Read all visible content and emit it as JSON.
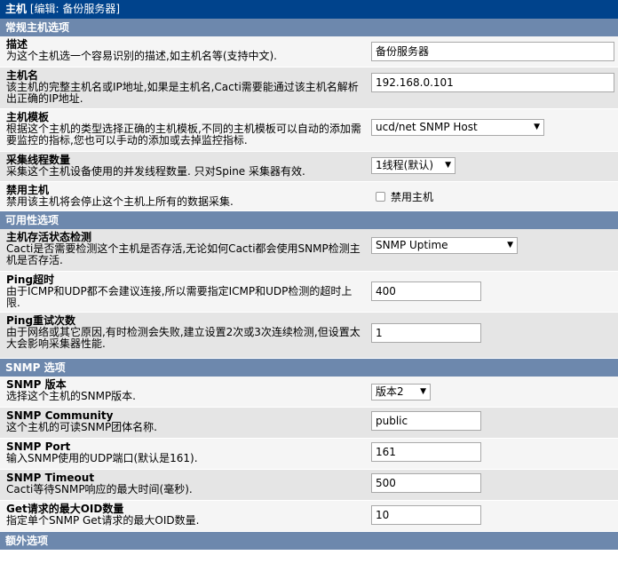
{
  "header": {
    "title": "主机",
    "subtitle": "[编辑: 备份服务器]"
  },
  "sections": {
    "general": "常规主机选项",
    "availability": "可用性选项",
    "snmp": "SNMP 选项",
    "additional": "额外选项"
  },
  "fields": {
    "description": {
      "name": "描述",
      "desc": "为这个主机选一个容易识别的描述,如主机名等(支持中文).",
      "value": "备份服务器"
    },
    "hostname": {
      "name": "主机名",
      "desc": "该主机的完整主机名或IP地址,如果是主机名,Cacti需要能通过该主机名解析出正确的IP地址.",
      "value": "192.168.0.101"
    },
    "template": {
      "name": "主机模板",
      "desc": "根据这个主机的类型选择正确的主机模板,不同的主机模板可以自动的添加需要监控的指标,您也可以手动的添加或去掉监控指标.",
      "value": "ucd/net SNMP Host"
    },
    "threads": {
      "name": "采集线程数量",
      "desc": "采集这个主机设备使用的并发线程数量. 只对Spine 采集器有效.",
      "value": "1线程(默认)"
    },
    "disable": {
      "name": "禁用主机",
      "desc": "禁用该主机将会停止这个主机上所有的数据采集.",
      "checkbox_label": "禁用主机",
      "checked": false
    },
    "availability_method": {
      "name": "主机存活状态检测",
      "desc": "Cacti是否需要检测这个主机是否存活,无论如何Cacti都会使用SNMP检测主机是否存活.",
      "value": "SNMP Uptime"
    },
    "ping_timeout": {
      "name": "Ping超时",
      "desc": "由于ICMP和UDP都不会建议连接,所以需要指定ICMP和UDP检测的超时上限.",
      "value": "400"
    },
    "ping_retries": {
      "name": "Ping重试次数",
      "desc": "由于网络或其它原因,有时检测会失败,建立设置2次或3次连续检测,但设置太大会影响采集器性能.",
      "value": "1"
    },
    "snmp_version": {
      "name": "SNMP 版本",
      "desc": "选择这个主机的SNMP版本.",
      "value": "版本2"
    },
    "snmp_community": {
      "name": "SNMP Community",
      "desc": "这个主机的可读SNMP团体名称.",
      "value": "public"
    },
    "snmp_port": {
      "name": "SNMP Port",
      "desc": "输入SNMP使用的UDP端口(默认是161).",
      "value": "161"
    },
    "snmp_timeout": {
      "name": "SNMP Timeout",
      "desc": "Cacti等待SNMP响应的最大时间(毫秒).",
      "value": "500"
    },
    "max_oids": {
      "name": "Get请求的最大OID数量",
      "desc": "指定单个SNMP Get请求的最大OID数量.",
      "value": "10"
    }
  },
  "icons": {
    "dropdown": "chevron-down-icon"
  }
}
